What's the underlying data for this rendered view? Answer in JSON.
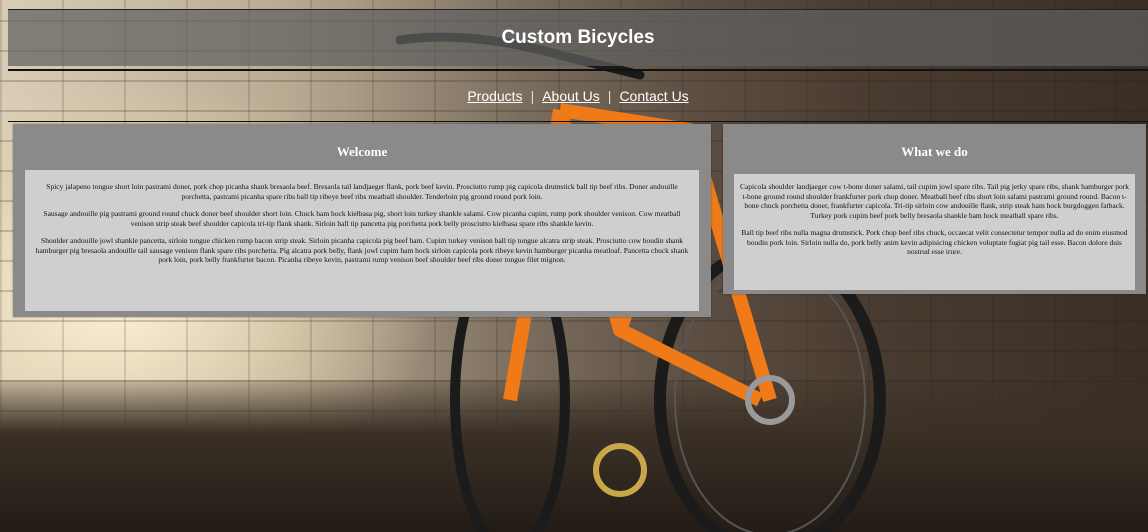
{
  "site": {
    "title": "Custom Bicycles"
  },
  "nav": {
    "items": [
      {
        "label": "Products"
      },
      {
        "label": "About Us"
      },
      {
        "label": "Contact Us"
      }
    ],
    "separator": "|"
  },
  "welcome": {
    "title": "Welcome",
    "paragraphs": [
      "Spicy jalapeno tongue short loin pastrami doner, pork chop picanha shank bresaola beef. Bresaola tail landjaeger flank, pork beef kevin. Prosciutto rump pig capicola drumstick ball tip beef ribs. Doner andouille porchetta, pastrami picanha spare ribs ball tip ribeye beef ribs meatball shoulder. Tenderloin pig ground round pork loin.",
      "Sausage andouille pig pastrami ground round chuck doner beef shoulder short loin. Chuck ham hock kielbasa pig, short loin turkey shankle salami. Cow picanha cupim, rump pork shoulder venison. Cow meatball venison strip steak beef shoulder capicola tri-tip flank shank. Sirloin ball tip pancetta pig porchetta pork belly prosciutto kielbasa spare ribs shankle kevin.",
      "Shoulder andouille jowl shankle pancetta, sirloin tongue chicken rump bacon strip steak. Sirloin picanha capicola pig beef ham. Cupim turkey venison ball tip tongue alcatra strip steak. Prosciutto cow boudin shank hamburger pig bresaola andouille tail sausage venison flank spare ribs porchetta. Pig alcatra pork belly, flank jowl cupim ham hock sirloin capicola pork ribeye kevin hamburger picanha meatloaf. Pancetta chuck shank pork loin, pork belly frankfurter bacon. Picanha ribeye kevin, pastrami rump venison beef shoulder beef ribs doner tongue filet mignon."
    ]
  },
  "what_we_do": {
    "title": "What we do",
    "paragraphs": [
      "Capicola shoulder landjaeger cow t-bone doner salami, tail cupim jowl spare ribs. Tail pig jerky spare ribs, shank hamburger pork t-bone ground round shoulder frankfurter pork chop doner. Meatball beef ribs short loin salami pastrami ground round. Bacon t-bone chuck porchetta doner, frankfurter capicola. Tri-tip sirloin cow andouille flank, strip steak ham hock burgdoggen fatback. Turkey pork cupim beef pork belly bresaola shankle ham hock meatball spare ribs.",
      "Ball tip beef ribs nulla magna drumstick. Pork chop beef ribs chuck, occaecat velit consectetur tempor nulla ad do enim eiusmod boudin pork loin. Sirloin nulla do, pork belly anim kevin adipisicing chicken voluptate fugiat pig tail esse. Bacon dolore duis nostrud esse irure."
    ]
  },
  "colors": {
    "panel_bg": "#8a8a8a",
    "panel_body_bg": "#cfcfcf",
    "bike_frame": "#f07a18"
  }
}
